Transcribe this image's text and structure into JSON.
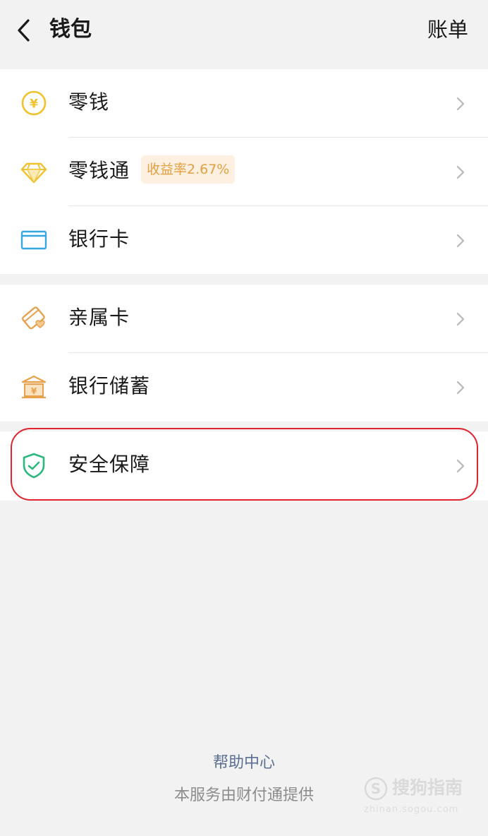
{
  "header": {
    "title": "钱包",
    "right_action": "账单"
  },
  "groups": [
    [
      {
        "label": "零钱",
        "icon": "yuan-coin-icon"
      },
      {
        "label": "零钱通",
        "icon": "diamond-icon",
        "badge": "收益率2.67%"
      },
      {
        "label": "银行卡",
        "icon": "bank-card-icon"
      }
    ],
    [
      {
        "label": "亲属卡",
        "icon": "family-card-icon"
      },
      {
        "label": "银行储蓄",
        "icon": "bank-savings-icon"
      }
    ],
    [
      {
        "label": "安全保障",
        "icon": "security-shield-icon"
      }
    ]
  ],
  "footer": {
    "help_link": "帮助中心",
    "provider_text": "本服务由财付通提供"
  },
  "watermark": {
    "text": "搜狗指南",
    "url_text": "zhinan.sogou.com"
  },
  "colors": {
    "background": "#f2f2f2",
    "link": "#5a6f91",
    "badge_text": "#e4a041",
    "badge_bg": "#fdf0e0",
    "highlight": "#e0232f",
    "shield": "#2bb77d",
    "card": "#35a8e0",
    "gold": "#f2c12e"
  }
}
